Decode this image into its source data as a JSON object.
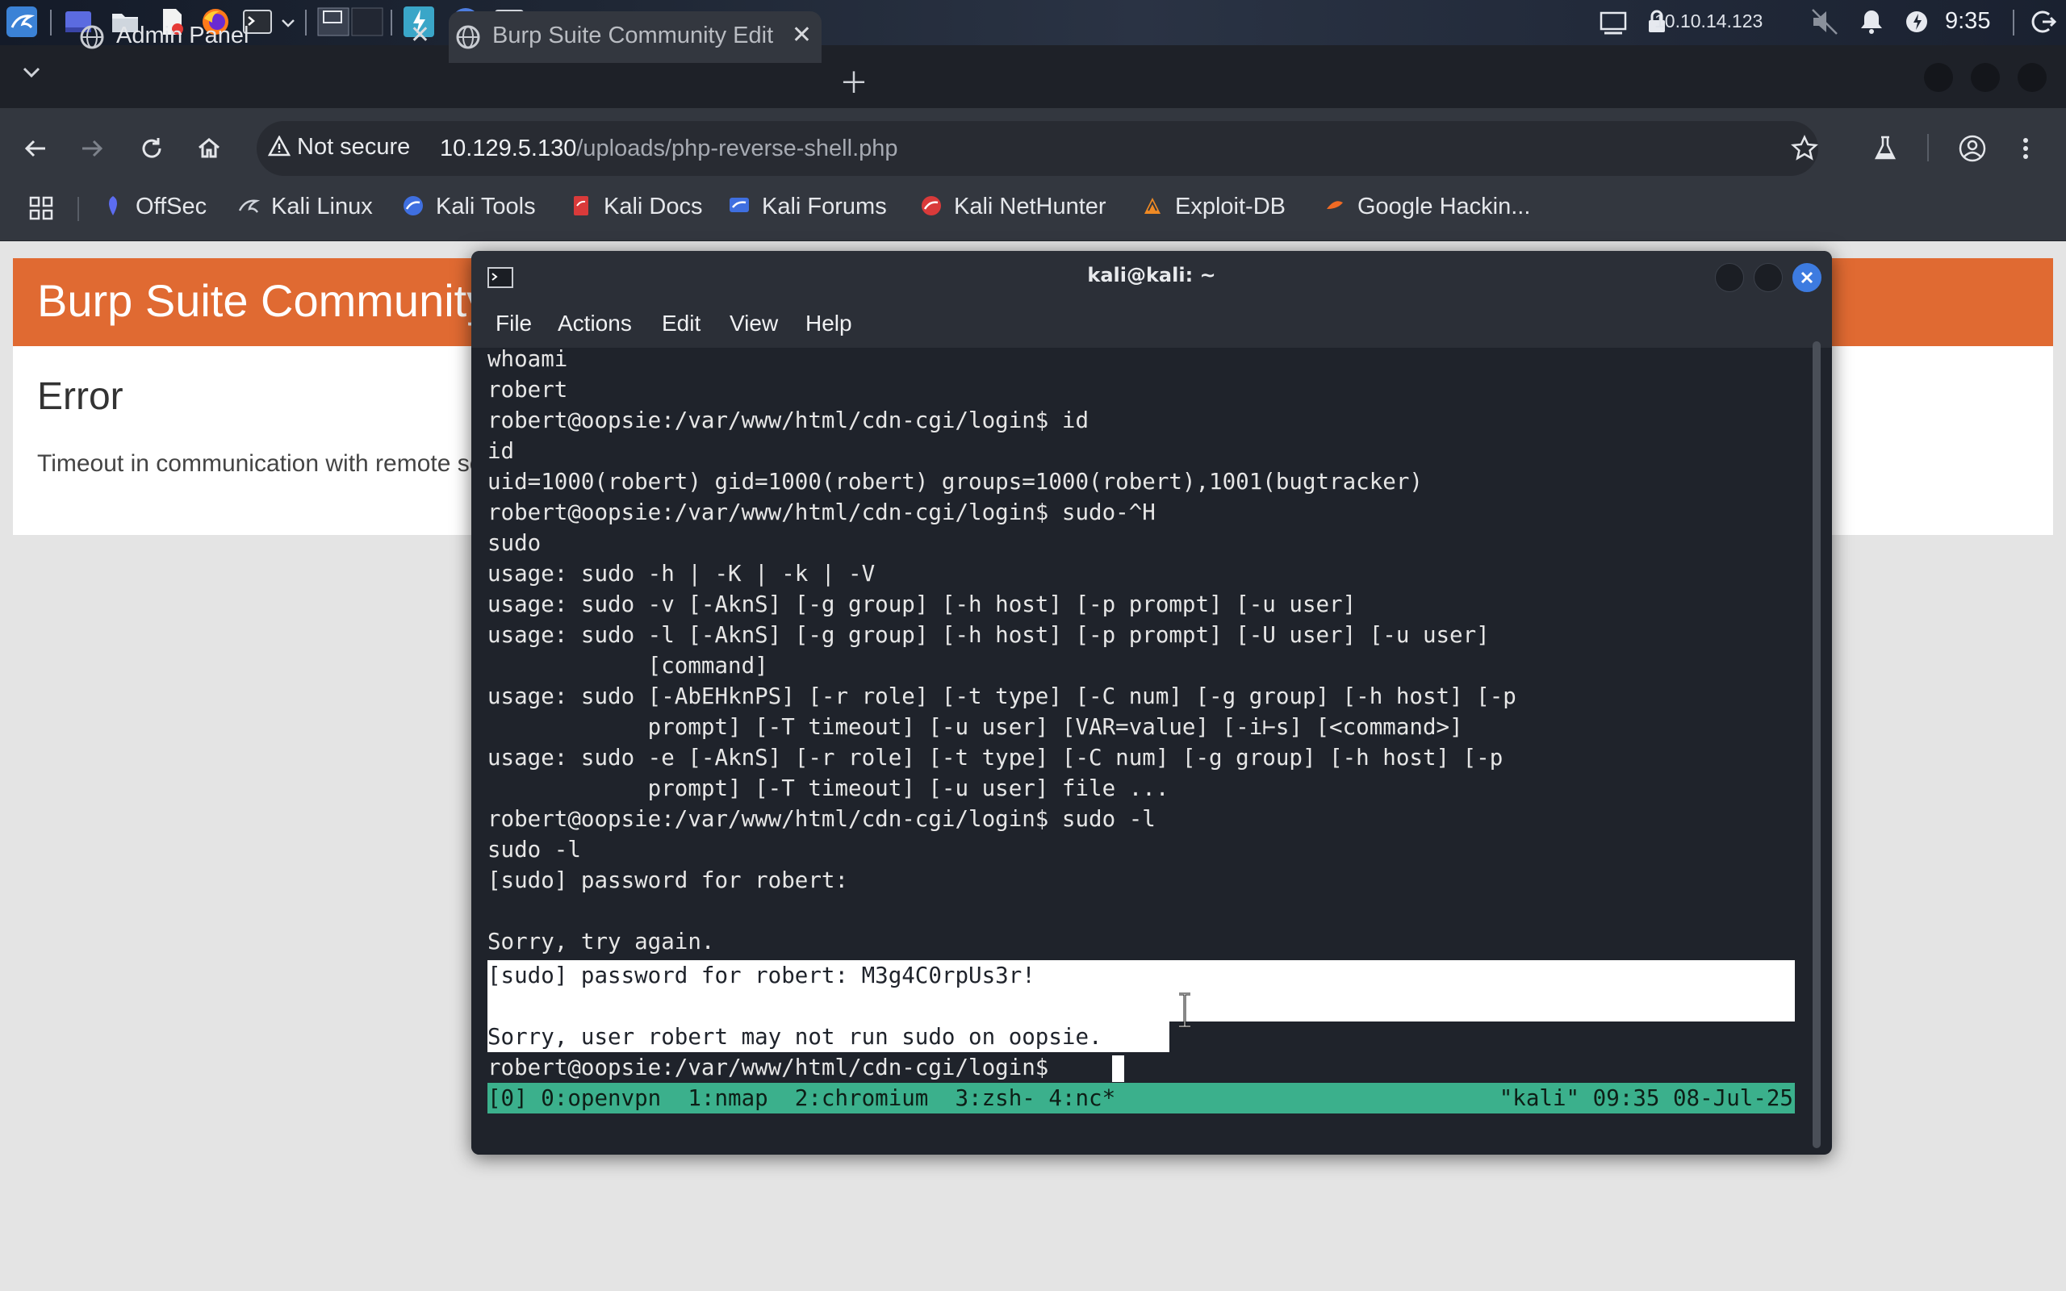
{
  "taskbar": {
    "network_ip": "10.10.14.123",
    "clock": "9:35"
  },
  "browser": {
    "tabs": [
      {
        "title": "Admin Panel",
        "active": false
      },
      {
        "title": "Burp Suite Community Edition",
        "active": true
      }
    ],
    "address": {
      "security_label": "Not secure",
      "host": "10.129.5.130",
      "path": "/uploads/php-reverse-shell.php"
    },
    "bookmarks": [
      "OffSec",
      "Kali Linux",
      "Kali Tools",
      "Kali Docs",
      "Kali Forums",
      "Kali NetHunter",
      "Exploit-DB",
      "Google Hackin..."
    ]
  },
  "page": {
    "banner_title": "Burp Suite Community Edition",
    "error_heading": "Error",
    "error_message": "Timeout in communication with remote server"
  },
  "terminal": {
    "title": "kali@kali: ~",
    "menu": [
      "File",
      "Actions",
      "Edit",
      "View",
      "Help"
    ],
    "lines": [
      "whoami",
      "robert",
      "robert@oopsie:/var/www/html/cdn-cgi/login$ id",
      "id",
      "uid=1000(robert) gid=1000(robert) groups=1000(robert),1001(bugtracker)",
      "robert@oopsie:/var/www/html/cdn-cgi/login$ sudo-^H",
      "sudo",
      "usage: sudo -h | -K | -k | -V",
      "usage: sudo -v [-AknS] [-g group] [-h host] [-p prompt] [-u user]",
      "usage: sudo -l [-AknS] [-g group] [-h host] [-p prompt] [-U user] [-u user]",
      "            [command]",
      "usage: sudo [-AbEHknPS] [-r role] [-t type] [-C num] [-g group] [-h host] [-p",
      "            prompt] [-T timeout] [-u user] [VAR=value] [-i⊢s] [<command>]",
      "usage: sudo -e [-AknS] [-r role] [-t type] [-C num] [-g group] [-h host] [-p",
      "            prompt] [-T timeout] [-u user] file ...",
      "robert@oopsie:/var/www/html/cdn-cgi/login$ sudo -l",
      "sudo -l",
      "[sudo] password for robert:",
      "",
      "Sorry, try again.",
      "[sudo] password for robert: M3g4C0rpUs3r!",
      "",
      "Sorry, user robert may not run sudo on oopsie.",
      "robert@oopsie:/var/www/html/cdn-cgi/login$ "
    ],
    "tmux_status_left": "[0] 0:openvpn  1:nmap  2:chromium  3:zsh- 4:nc*",
    "tmux_status_right": "\"kali\" 09:35 08-Jul-25"
  }
}
